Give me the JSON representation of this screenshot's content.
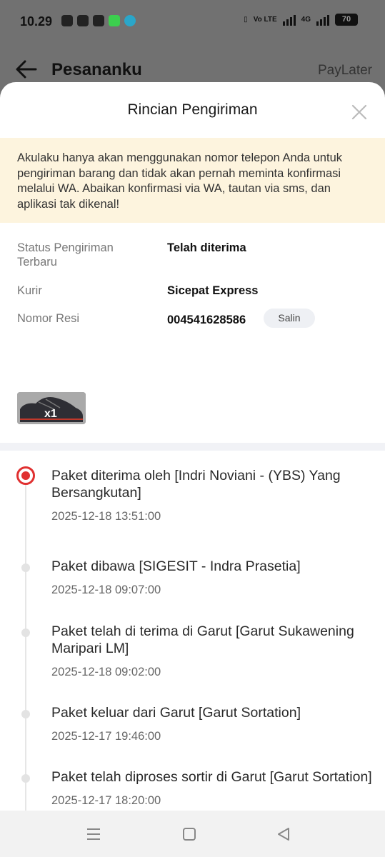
{
  "status_bar": {
    "time": "10.29",
    "network": "Vo LTE",
    "network2": "4G",
    "battery": "70"
  },
  "background_header": {
    "title": "Pesananku",
    "right_link": "PayLater"
  },
  "sheet": {
    "title": "Rincian Pengiriman",
    "notice": "Akulaku hanya akan menggunakan nomor telepon Anda untuk pengiriman barang dan tidak akan pernah meminta konfirmasi melalui WA. Abaikan konfirmasi via WA, tautan via sms, dan aplikasi tak dikenal!",
    "info": {
      "status_label": "Status Pengiriman Terbaru",
      "status_value": "Telah diterima",
      "courier_label": "Kurir",
      "courier_value": "Sicepat Express",
      "resi_label": "Nomor Resi",
      "resi_value": "004541628586",
      "copy_label": "Salin"
    },
    "product": {
      "quantity": "x1",
      "icon": "sneaker-thumbnail"
    },
    "timeline": [
      {
        "title": " Paket diterima oleh [Indri Noviani - (YBS) Yang Bersangkutan]",
        "time": "2025-12-18 13:51:00",
        "active": true
      },
      {
        "title": "Paket dibawa [SIGESIT - Indra Prasetia]",
        "time": "2025-12-18 09:07:00",
        "active": false
      },
      {
        "title": "Paket telah di terima di Garut [Garut Sukawening Maripari LM]",
        "time": "2025-12-18 09:02:00",
        "active": false
      },
      {
        "title": "Paket keluar dari Garut [Garut Sortation]",
        "time": "2025-12-17 19:46:00",
        "active": false
      },
      {
        "title": "Paket telah diproses sortir di Garut [Garut Sortation]",
        "time": "2025-12-17 18:20:00",
        "active": false
      }
    ]
  },
  "colors": {
    "accent_red": "#e03030",
    "notice_bg": "#fdf4de"
  }
}
